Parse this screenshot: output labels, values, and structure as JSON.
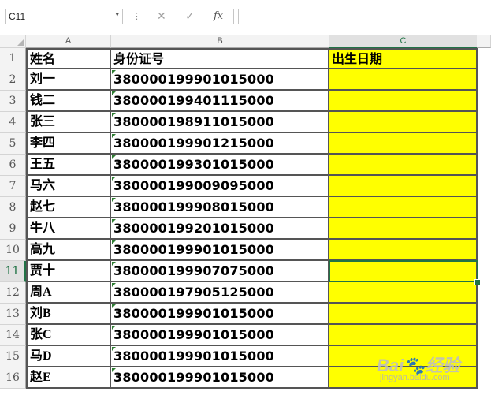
{
  "formula_bar": {
    "name_box": "C11",
    "name_box_arrow": "▾",
    "dots": "⋮",
    "cancel_icon": "✕",
    "enter_icon": "✓",
    "fx_icon": "fx",
    "formula": ""
  },
  "columns": [
    "A",
    "B",
    "C"
  ],
  "rows": [
    "1",
    "2",
    "3",
    "4",
    "5",
    "6",
    "7",
    "8",
    "9",
    "10",
    "11",
    "12",
    "13",
    "14",
    "15",
    "16"
  ],
  "header": {
    "name": "姓名",
    "id": "身份证号",
    "birth": "出生日期"
  },
  "data": [
    {
      "name": "刘一",
      "id": "380000199901015000",
      "birth": ""
    },
    {
      "name": "钱二",
      "id": "380000199401115000",
      "birth": ""
    },
    {
      "name": "张三",
      "id": "380000198911015000",
      "birth": ""
    },
    {
      "name": "李四",
      "id": "380000199901215000",
      "birth": ""
    },
    {
      "name": "王五",
      "id": "380000199301015000",
      "birth": ""
    },
    {
      "name": "马六",
      "id": "380000199009095000",
      "birth": ""
    },
    {
      "name": "赵七",
      "id": "380000199908015000",
      "birth": ""
    },
    {
      "name": "牛八",
      "id": "380000199201015000",
      "birth": ""
    },
    {
      "name": "高九",
      "id": "380000199901015000",
      "birth": ""
    },
    {
      "name": "贾十",
      "id": "380000199907075000",
      "birth": ""
    },
    {
      "name": "周A",
      "id": "380000197905125000",
      "birth": ""
    },
    {
      "name": "刘B",
      "id": "380000199901015000",
      "birth": ""
    },
    {
      "name": "张C",
      "id": "380000199901015000",
      "birth": ""
    },
    {
      "name": "马D",
      "id": "380000199901015000",
      "birth": ""
    },
    {
      "name": "赵E",
      "id": "380000199901015000",
      "birth": ""
    }
  ],
  "selected": {
    "column": "C",
    "row": "11"
  },
  "colors": {
    "highlight": "#ffff00",
    "accent": "#217346",
    "border": "#555555"
  },
  "watermark": {
    "text": "Bai🐾经验",
    "sub": "jingyan.baidu.com"
  }
}
